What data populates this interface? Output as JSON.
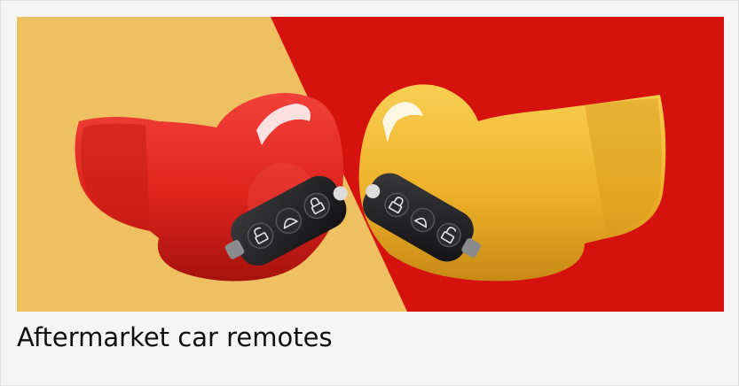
{
  "card": {
    "caption": "Aftermarket car remotes"
  },
  "colors": {
    "background_left": "#eec062",
    "background_right": "#d6120f",
    "glove_red": "#e32a22",
    "glove_yellow": "#f0b62c",
    "key_fob": "#1d1d1f"
  },
  "image": {
    "icons": [
      "red-boxing-glove-icon",
      "yellow-boxing-glove-icon",
      "car-key-fob-icon",
      "lock-icon",
      "unlock-icon",
      "trunk-icon"
    ]
  }
}
